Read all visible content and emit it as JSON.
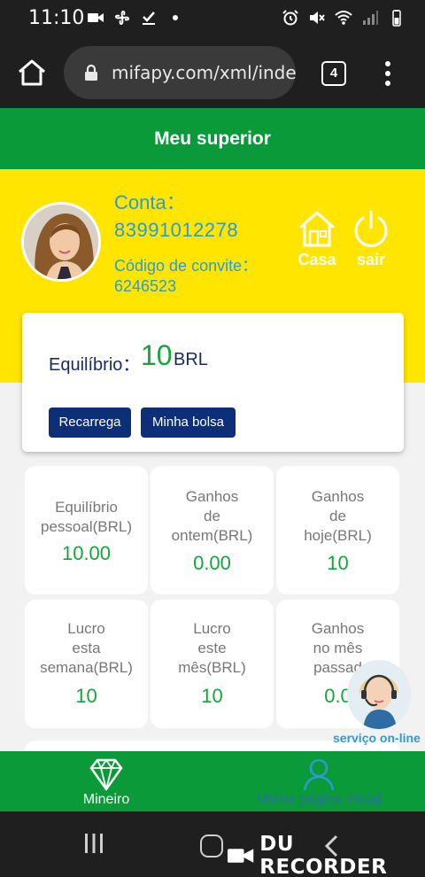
{
  "status_bar": {
    "time": "11:10",
    "left_icons": [
      "video-icon",
      "fan-icon",
      "download-done-icon",
      "dot-icon"
    ],
    "right_icons": [
      "alarm-icon",
      "mute-icon",
      "wifi-icon",
      "signal-icon",
      "battery-icon"
    ]
  },
  "browser": {
    "url": "mifapy.com/xml/index·",
    "tab_count": "4"
  },
  "header": {
    "title": "Meu superior"
  },
  "profile": {
    "account_label": "Conta：",
    "account_number": "83991012278",
    "invite_label": "Código de convite：",
    "invite_code": "6246523",
    "home_label": "Casa",
    "logout_label": "sair"
  },
  "balance": {
    "label": "Equilíbrio：",
    "value": "10",
    "unit": "BRL",
    "recharge_label": "Recarrega",
    "wallet_label": "Minha bolsa"
  },
  "stats": [
    {
      "label_lines": [
        "Equilíbrio",
        "pessoal(BRL)"
      ],
      "value": "10.00"
    },
    {
      "label_lines": [
        "Ganhos",
        "de",
        "ontem(BRL)"
      ],
      "value": "0.00"
    },
    {
      "label_lines": [
        "Ganhos",
        "de",
        "hoje(BRL)"
      ],
      "value": "10"
    },
    {
      "label_lines": [
        "Lucro",
        "esta",
        "semana(BRL)"
      ],
      "value": "10"
    },
    {
      "label_lines": [
        "Lucro",
        "este",
        "mês(BRL)"
      ],
      "value": "10"
    },
    {
      "label_lines": [
        "Ganhos",
        "no mês",
        "passad"
      ],
      "value": "0.0"
    }
  ],
  "support": {
    "label": "serviço on-line"
  },
  "bottom_nav": {
    "miner_label": "Mineiro",
    "home_label": "Minha página inicial"
  },
  "watermark": {
    "text": "DU RECORDER"
  },
  "colors": {
    "green": "#0a9a3a",
    "yellow": "#ffe500",
    "blue_text": "#2d9bd1",
    "navy": "#0d2f78",
    "value_green": "#14a63a"
  }
}
